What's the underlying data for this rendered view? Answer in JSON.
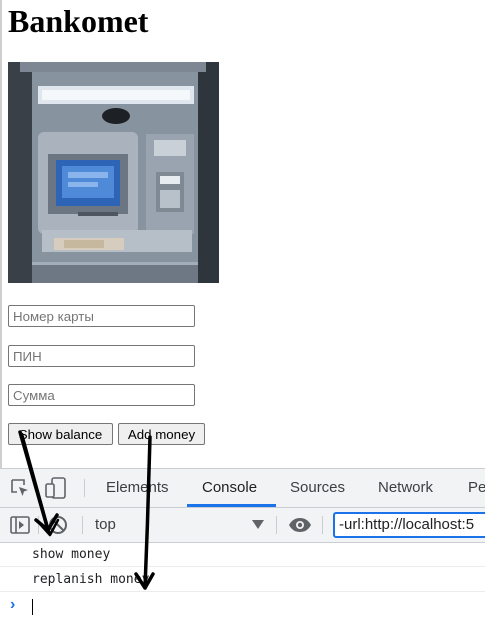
{
  "page": {
    "title": "Bankomet"
  },
  "form": {
    "card_placeholder": "Номер карты",
    "pin_placeholder": "ПИН",
    "sum_placeholder": "Сумма",
    "show_balance_label": "Show balance",
    "add_money_label": "Add money"
  },
  "devtools": {
    "tabs": [
      "Elements",
      "Console",
      "Sources",
      "Network",
      "Pe"
    ],
    "active_tab": "Console",
    "context": "top",
    "filter_value": "-url:http://localhost:5",
    "log_lines": [
      "show money",
      "replanish money"
    ],
    "prompt_symbol": "›"
  },
  "colors": {
    "accent": "#1a73e8",
    "devtools_bg": "#f1f3f4"
  },
  "icons": [
    "inspect-element-icon",
    "device-toggle-icon",
    "sidebar-toggle-icon",
    "clear-console-icon",
    "dropdown-arrow-icon",
    "eye-icon",
    "prompt-chevron-icon"
  ]
}
